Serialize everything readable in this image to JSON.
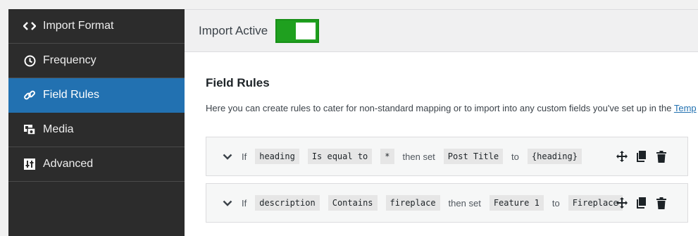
{
  "sidebar": {
    "items": [
      {
        "label": "Import Format",
        "icon": "code-icon",
        "active": false
      },
      {
        "label": "Frequency",
        "icon": "clock-icon",
        "active": false
      },
      {
        "label": "Field Rules",
        "icon": "link-icon",
        "active": true
      },
      {
        "label": "Media",
        "icon": "media-icon",
        "active": false
      },
      {
        "label": "Advanced",
        "icon": "advanced-icon",
        "active": false
      }
    ]
  },
  "header": {
    "title": "Import Active",
    "toggle_on": true
  },
  "main": {
    "section_title": "Field Rules",
    "description": "Here you can create rules to cater for non-standard mapping or to import into any custom fields you've set up in the ",
    "description_link": "Temp"
  },
  "rules": [
    {
      "if_text": "If",
      "field": "heading",
      "condition": "Is equal to",
      "value": "*",
      "then_text": "then set",
      "target": "Post Title",
      "to_text": "to",
      "result": "{heading}"
    },
    {
      "if_text": "If",
      "field": "description",
      "condition": "Contains",
      "value": "fireplace",
      "then_text": "then set",
      "target": "Feature 1",
      "to_text": "to",
      "result": "Fireplace"
    }
  ],
  "colors": {
    "sidebar_bg": "#2c2c2c",
    "active_bg": "#2271b1",
    "toggle_on": "#1fa01f"
  }
}
